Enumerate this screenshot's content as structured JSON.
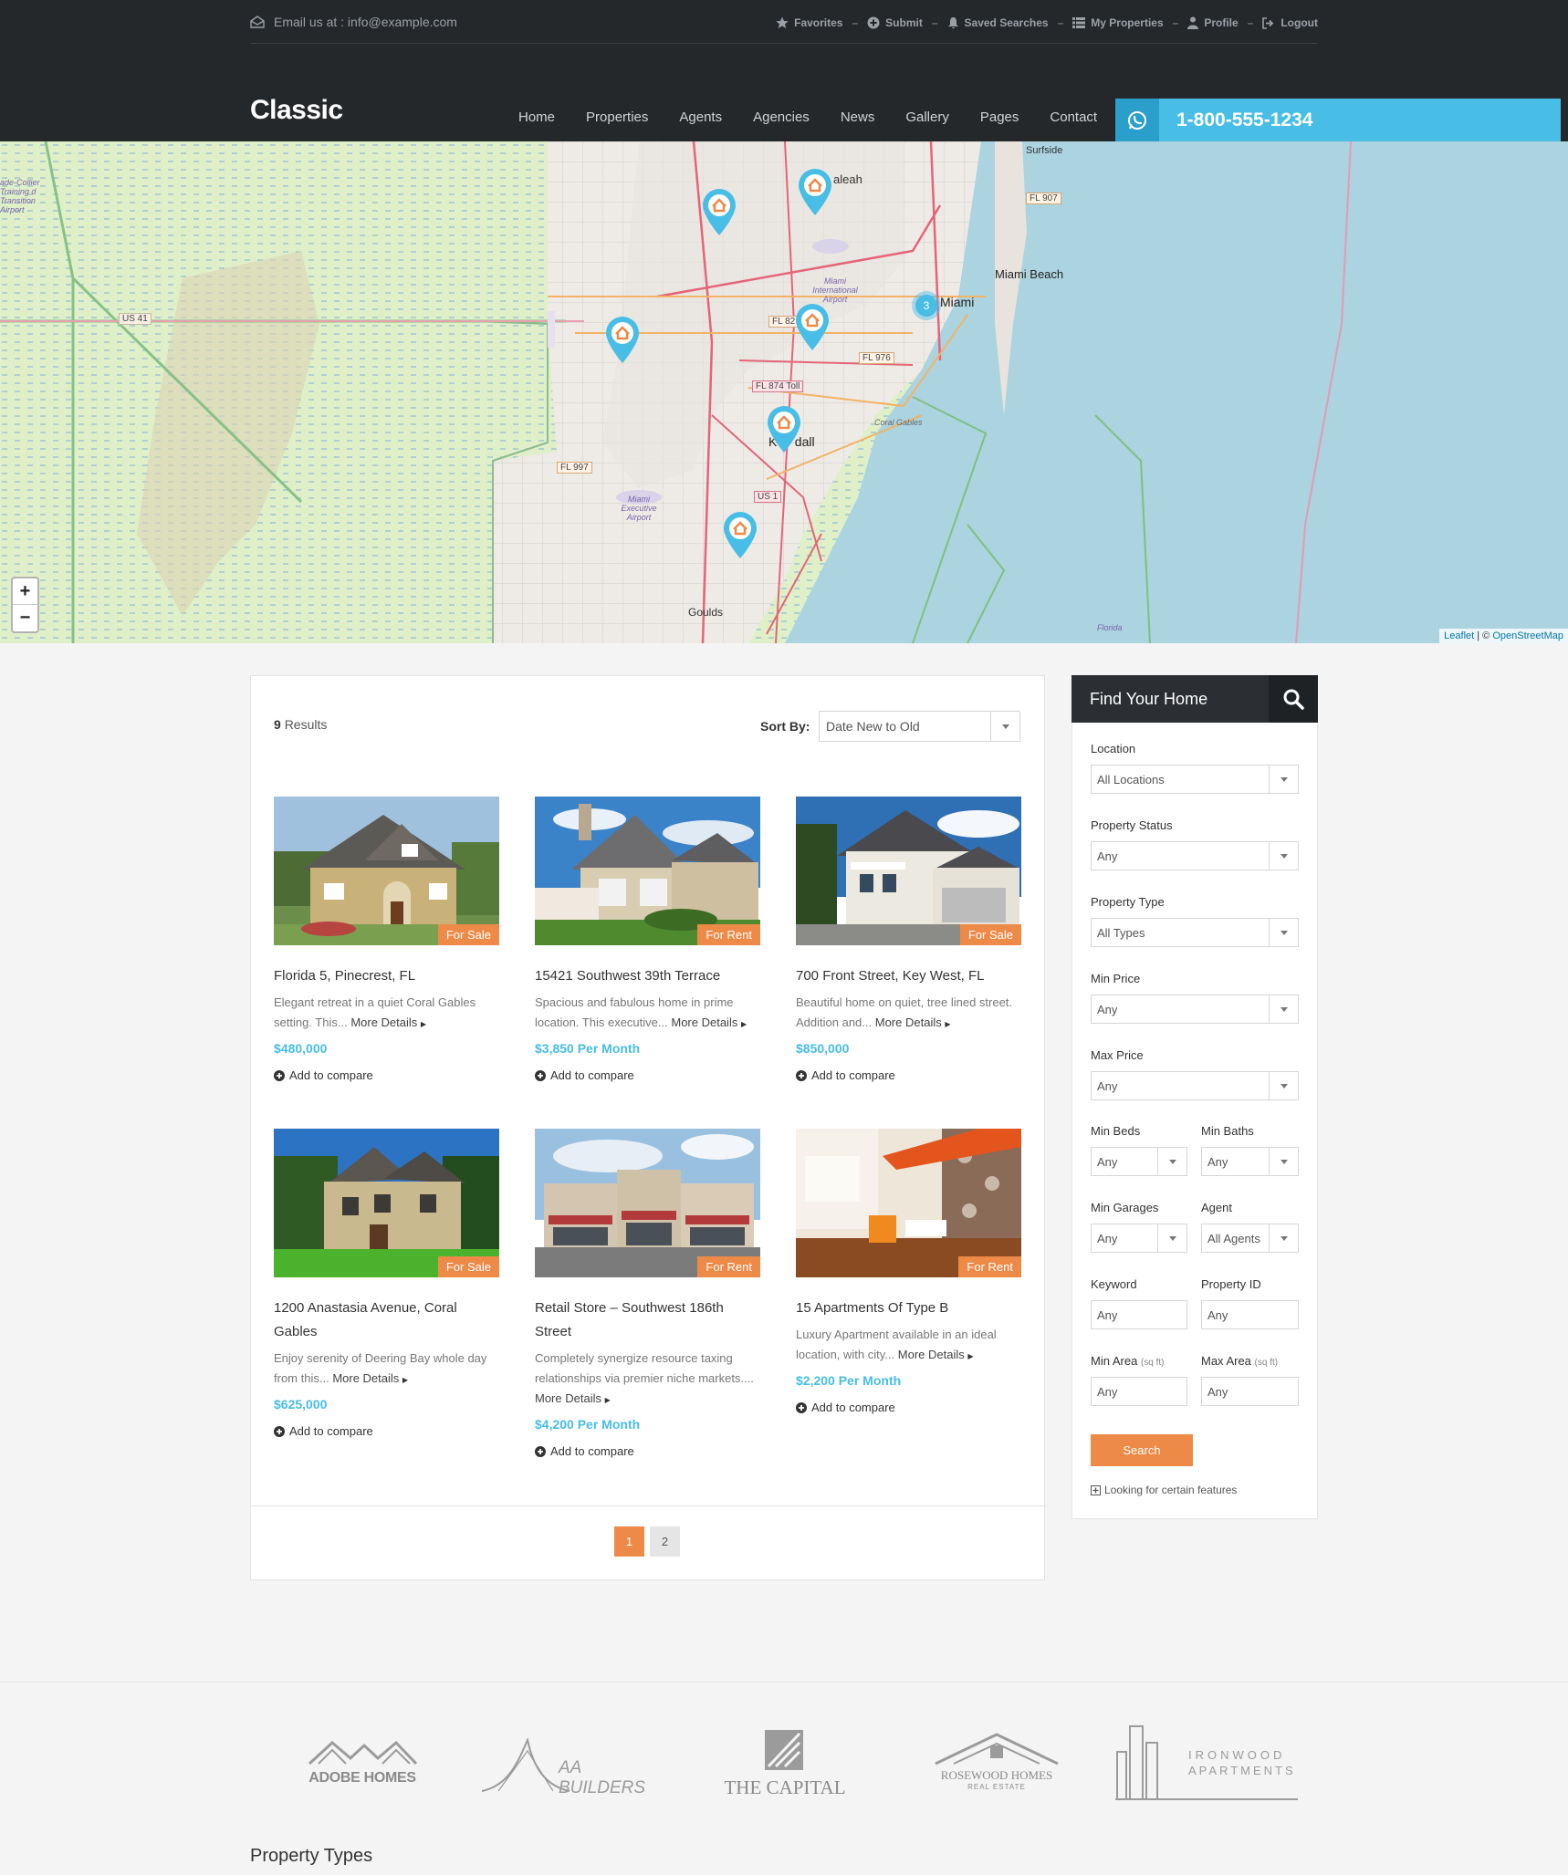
{
  "topbar": {
    "email": "Email us at : info@example.com",
    "links": [
      {
        "label": "Favorites",
        "icon": "star-icon"
      },
      {
        "label": "Submit",
        "icon": "plus-circle-icon"
      },
      {
        "label": "Saved Searches",
        "icon": "bell-icon"
      },
      {
        "label": "My Properties",
        "icon": "list-icon"
      },
      {
        "label": "Profile",
        "icon": "user-icon"
      },
      {
        "label": "Logout",
        "icon": "logout-icon"
      }
    ]
  },
  "header": {
    "logo": "Classic",
    "nav": [
      "Home",
      "Properties",
      "Agents",
      "Agencies",
      "News",
      "Gallery",
      "Pages",
      "Contact"
    ],
    "phone": "1-800-555-1234",
    "phone_icon": "whatsapp-icon"
  },
  "map": {
    "labels": {
      "surfside": "Surfside",
      "hialeah": "aleah",
      "miami_beach": "Miami Beach",
      "miami": "Miami",
      "kendall": "K     dall",
      "goulds": "Goulds",
      "us41": "US 41",
      "fl907": "FL 907",
      "fl82": "FL 82",
      "fl976": "FL 976",
      "fl874": "FL 874 Toll",
      "fl997": "FL 997",
      "us1": "US 1",
      "coral_gables": "Coral Gables",
      "mia_airport": "Miami International Airport",
      "exec_airport": "Miami Executive Airport",
      "training_airport": "ade-Collier Training d Transition Airport",
      "florida": "Florida"
    },
    "cluster_count": "3",
    "zoom_in": "+",
    "zoom_out": "−",
    "attribution_leaflet": "Leaflet",
    "attribution_sep": " | © ",
    "attribution_osm": "OpenStreetMap"
  },
  "listing": {
    "results_count": "9",
    "results_label": "Results",
    "sort_label": "Sort By:",
    "sort_value": "Date New to Old",
    "more": "More Details",
    "compare": "Add to compare",
    "cards": [
      {
        "title": "Florida 5, Pinecrest, FL",
        "desc": "Elegant retreat in a quiet Coral Gables setting. This...",
        "price": "$480,000",
        "status": "For Sale"
      },
      {
        "title": "15421 Southwest 39th Terrace",
        "desc": "Spacious and fabulous home in prime location. This executive...",
        "price": "$3,850 Per Month",
        "status": "For Rent"
      },
      {
        "title": "700 Front Street, Key West, FL",
        "desc": "Beautiful home on quiet, tree lined street. Addition and...",
        "price": "$850,000",
        "status": "For Sale"
      },
      {
        "title": "1200 Anastasia Avenue, Coral Gables",
        "desc": "Enjoy serenity of Deering Bay whole day from this...",
        "price": "$625,000",
        "status": "For Sale"
      },
      {
        "title": "Retail Store – Southwest 186th Street",
        "desc": "Completely synergize resource taxing relationships via premier niche markets....",
        "price": "$4,200 Per Month",
        "status": "For Rent"
      },
      {
        "title": "15 Apartments Of Type B",
        "desc": "Luxury Apartment available in an ideal location, with city...",
        "price": "$2,200 Per Month",
        "status": "For Rent"
      }
    ],
    "pages": [
      "1",
      "2"
    ],
    "current_page": "1"
  },
  "search": {
    "title": "Find Your Home",
    "location_label": "Location",
    "location_value": "All Locations",
    "status_label": "Property Status",
    "status_value": "Any",
    "type_label": "Property Type",
    "type_value": "All Types",
    "min_price_label": "Min Price",
    "min_price_value": "Any",
    "max_price_label": "Max Price",
    "max_price_value": "Any",
    "min_beds_label": "Min Beds",
    "min_beds_value": "Any",
    "min_baths_label": "Min Baths",
    "min_baths_value": "Any",
    "min_garages_label": "Min Garages",
    "min_garages_value": "Any",
    "agent_label": "Agent",
    "agent_value": "All Agents",
    "keyword_label": "Keyword",
    "keyword_value": "Any",
    "property_id_label": "Property ID",
    "property_id_value": "Any",
    "min_area_label": "Min Area",
    "max_area_label": "Max Area",
    "area_unit": "(sq ft)",
    "min_area_value": "Any",
    "max_area_value": "Any",
    "button": "Search",
    "features_link": "Looking for certain features"
  },
  "brands": {
    "adobe": "ADOBE HOMES",
    "aa": "AA BUILDERS",
    "capital": "THE CAPITAL",
    "rosewood": "ROSEWOOD HOMES",
    "rosewood_sub": "REAL ESTATE",
    "ironwood1": "IRONWOOD",
    "ironwood2": "APARTMENTS"
  },
  "footer": {
    "property_types": "Property Types"
  },
  "colors": {
    "accent": "#ee8a48",
    "blue": "#48bde6",
    "dark": "#25282b"
  }
}
